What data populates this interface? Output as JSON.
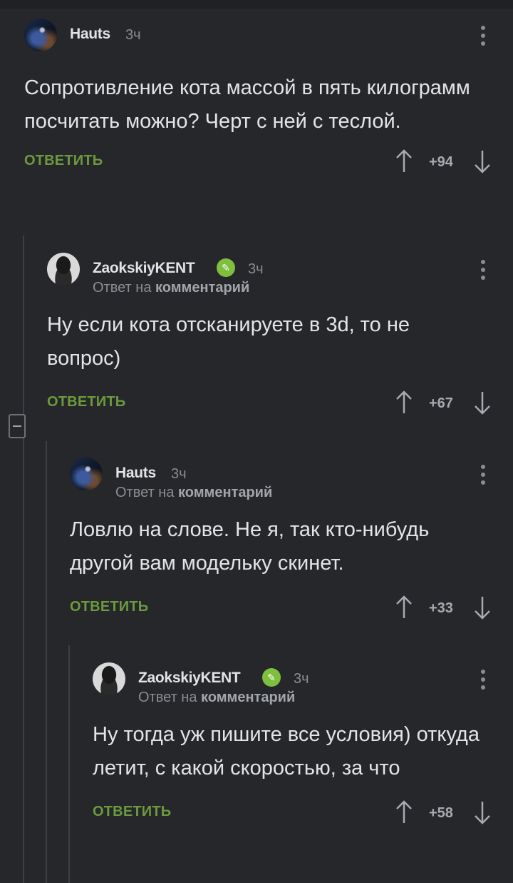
{
  "comments": [
    {
      "author": "Hauts",
      "time": "3ч",
      "text": "Сопротивление кота массой в пять килограмм посчитать можно? Черт с ней с теслой.",
      "reply_label": "ОТВЕТИТЬ",
      "score": "+94",
      "verified": false
    },
    {
      "author": "ZaokskiyKENT",
      "time": "3ч",
      "reply_to_prefix": "Ответ на",
      "reply_to_link": "комментарий",
      "text": "Ну если кота отсканируете в 3d, то не вопрос)",
      "reply_label": "ОТВЕТИТЬ",
      "score": "+67",
      "verified": true
    },
    {
      "author": "Hauts",
      "time": "3ч",
      "reply_to_prefix": "Ответ на",
      "reply_to_link": "комментарий",
      "text": "Ловлю на слове. Не я, так кто-нибудь другой вам модельку скинет.",
      "reply_label": "ОТВЕТИТЬ",
      "score": "+33",
      "verified": false
    },
    {
      "author": "ZaokskiyKENT",
      "time": "3ч",
      "reply_to_prefix": "Ответ на",
      "reply_to_link": "комментарий",
      "text": "Ну тогда уж пишите все условия) откуда летит, с какой скоростью, за что",
      "reply_label": "ОТВЕТИТЬ",
      "score": "+58",
      "verified": true
    }
  ],
  "colors": {
    "background": "#25272b",
    "accent_green": "#6c9a3d",
    "verified_badge": "#7fbf3f",
    "muted_text": "#8a8d92"
  },
  "icons": {
    "upvote": "arrow-up-icon",
    "downvote": "arrow-down-icon",
    "menu": "more-vertical-icon",
    "verified": "pencil-check-icon",
    "collapse": "minus-square-icon"
  }
}
